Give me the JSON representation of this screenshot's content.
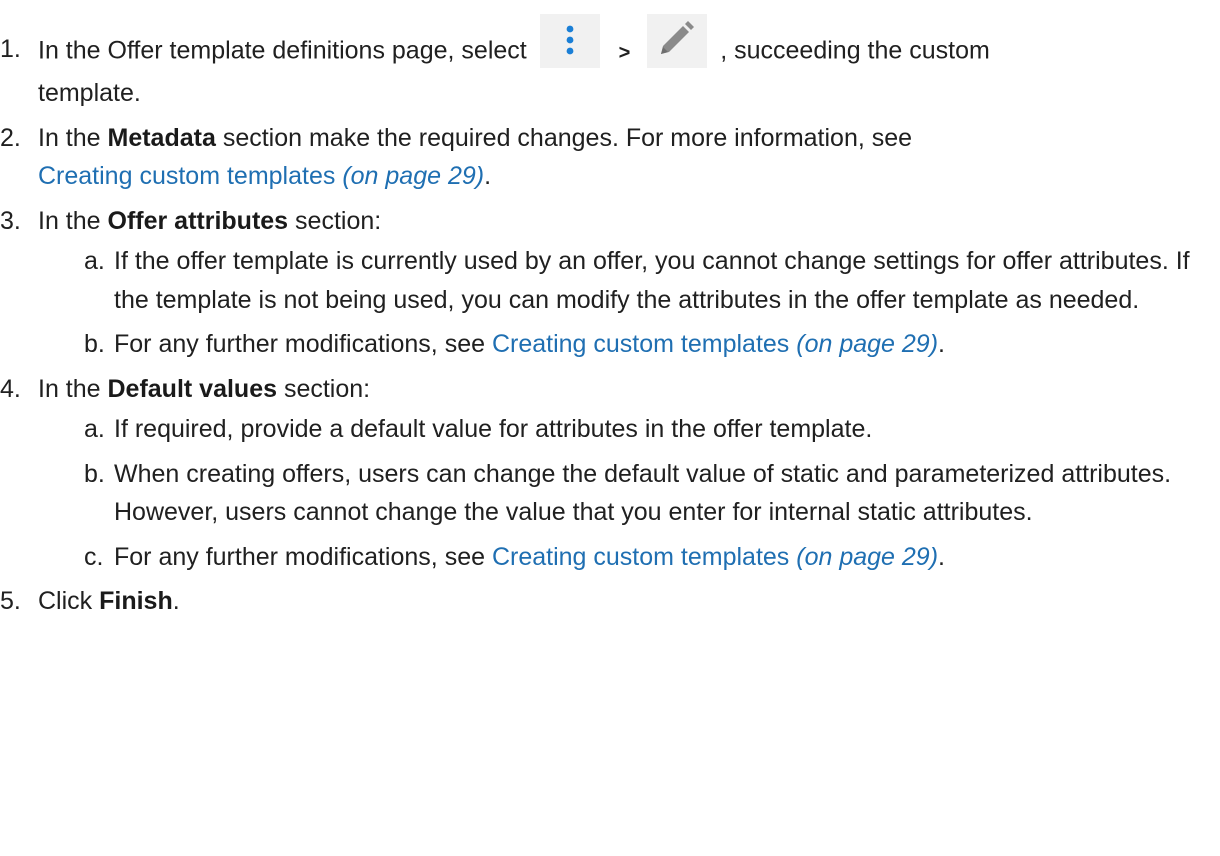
{
  "steps": [
    {
      "number": "1.",
      "text_before": "In the Offer template definitions page, select",
      "separator": ">",
      "text_after": ", succeeding the custom",
      "text_wrap": "template.",
      "icons": [
        "kebab-menu-icon",
        "pencil-edit-icon"
      ]
    },
    {
      "number": "2.",
      "text_before": "In the ",
      "bold": "Metadata",
      "text_after": " section make the required changes. For more information, see",
      "link_text": "Creating custom templates",
      "link_page": "(on page 29)",
      "link_end": "."
    },
    {
      "number": "3.",
      "text_before": "In the ",
      "bold": "Offer attributes",
      "text_after": " section:",
      "sub": [
        {
          "letter": "a.",
          "text": "If the offer template is currently used by an offer, you cannot change settings for offer attributes. If the template is not being used, you can modify the attributes in the offer template as needed."
        },
        {
          "letter": "b.",
          "text": "For any further modifications, see ",
          "link_text": "Creating custom templates",
          "link_page": "(on page 29)",
          "link_end": "."
        }
      ]
    },
    {
      "number": "4.",
      "text_before": "In the ",
      "bold": "Default values",
      "text_after": " section:",
      "sub": [
        {
          "letter": "a.",
          "text": "If required, provide a default value for attributes in the offer template."
        },
        {
          "letter": "b.",
          "text": "When creating offers, users can change the default value of static and parameterized attributes. However, users cannot change the value that you enter for internal static attributes."
        },
        {
          "letter": "c.",
          "text": "For any further modifications, see ",
          "link_text": "Creating custom templates",
          "link_page": "(on page 29)",
          "link_end": "."
        }
      ]
    },
    {
      "number": "5.",
      "text_before": "Click ",
      "bold": "Finish",
      "text_after": "."
    }
  ],
  "colors": {
    "link": "#1f6fb2",
    "text": "#202020",
    "icon_bg": "#f1f1f1",
    "kebab": "#1a7fd6",
    "pencil": "#8a8a8a"
  }
}
